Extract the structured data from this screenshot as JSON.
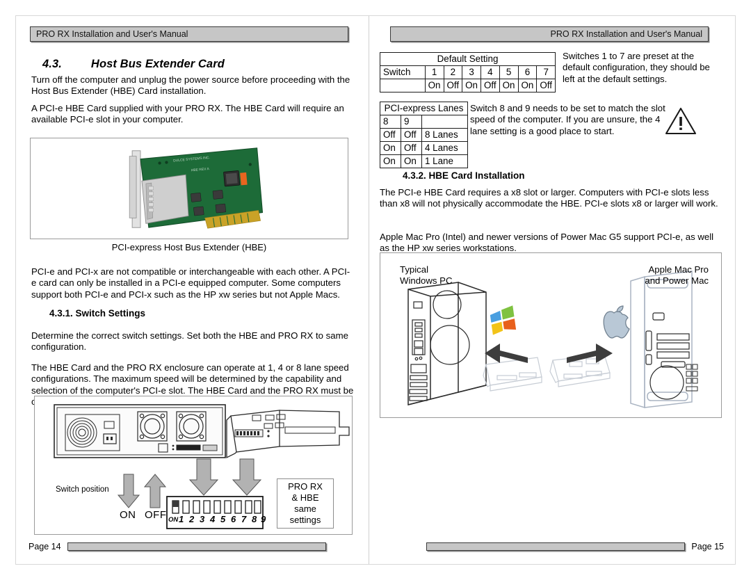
{
  "document": {
    "header_text": "PRO RX Installation and User's Manual"
  },
  "left_page": {
    "page_label": "Page 14",
    "section": {
      "number": "4.3.",
      "title": "Host Bus Extender Card"
    },
    "paragraphs": {
      "p1": "Turn off the computer and unplug the power source before proceeding with the Host Bus Extender (HBE) Card  installation.",
      "p2": "A PCI-e HBE Card supplied with your PRO RX.  The HBE Card will require an available PCI-e slot in your computer.",
      "p3": "PCI-e and PCI-x are not compatible or interchangeable with each other.  A PCI-e card can only be installed in a PCI-e equipped computer.  Some computers support both PCI-e and PCI-x such as the HP xw series but not Apple Macs.",
      "p4": "Determine the correct switch settings.  Set both the HBE and PRO RX to same configuration.",
      "p5": "The HBE Card and the PRO RX enclosure can operate at 1, 4 or 8 lane speed configurations.  The maximum speed will be determined by the capability and selection of the computer's PCI-e slot.  The HBE Card and the PRO RX must be configured to match the speed of the computer PCI-express slot."
    },
    "figure_caption": "PCI-express Host Bus Extender (HBE)",
    "subsection": {
      "number_title": "4.3.1. Switch Settings"
    },
    "switch_figure": {
      "switch_position_label": "Switch position",
      "on_label": "ON",
      "off_label": "OFF",
      "dip_on_marker": "ON",
      "dip_numbers": [
        "1",
        "2",
        "3",
        "4",
        "5",
        "6",
        "7",
        "8",
        "9"
      ],
      "note_box_lines": [
        "PRO RX",
        "& HBE",
        "same",
        "settings"
      ]
    }
  },
  "right_page": {
    "page_label": "Page 15",
    "default_setting_table": {
      "title": "Default Setting",
      "row_label": "Switch",
      "switch_numbers": [
        "1",
        "2",
        "3",
        "4",
        "5",
        "6",
        "7"
      ],
      "switch_states": [
        "On",
        "Off",
        "On",
        "Off",
        "On",
        "On",
        "Off"
      ]
    },
    "default_setting_note": "Switches 1 to 7 are preset at the default configuration, they should be left at the default settings.",
    "lanes_table": {
      "title": "PCI-express Lanes",
      "header": [
        "8",
        "9",
        ""
      ],
      "rows": [
        [
          "Off",
          "Off",
          "8 Lanes"
        ],
        [
          "On",
          "Off",
          "4 Lanes"
        ],
        [
          "On",
          "On",
          "1 Lane"
        ]
      ]
    },
    "lanes_note": "Switch 8 and 9 needs to be set to match the slot speed of the computer.  If you are unsure, the 4 lane setting is a good place to start.",
    "subsection": {
      "number_title": "4.3.2. HBE Card Installation"
    },
    "paragraphs": {
      "p1": "The PCI-e HBE Card requires a x8 slot or larger.  Computers with PCI-e slots less than x8 will not physically accommodate the HBE.  PCI-e slots x8 or larger will work.",
      "p2": "Apple Mac Pro (Intel) and newer versions of Power Mac G5 support PCI-e, as well as the HP xw series workstations."
    },
    "computer_figure": {
      "left_label": "Typical\nWindows PC",
      "right_label": "Apple Mac Pro\nand Power Mac"
    }
  },
  "colors": {
    "header_fill": "#c6c6c6",
    "header_border": "#3a3a3a",
    "page_border": "#d8d8d8",
    "table_border": "#1a1a1a",
    "arrow_gray": "#9e9e9e",
    "card_green": "#1f6b37"
  }
}
